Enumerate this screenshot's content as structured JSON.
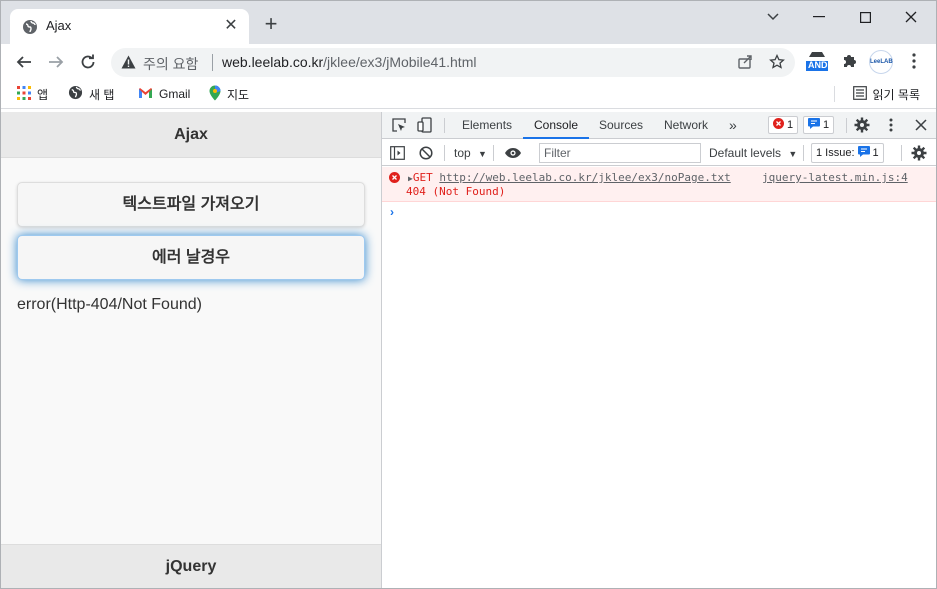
{
  "browser": {
    "tab": {
      "title": "Ajax",
      "favicon": "globe-icon"
    },
    "address": {
      "security_warning": "주의 요함",
      "url_host": "web.leelab.co.kr",
      "url_path": "/jklee/ex3/jMobile41.html"
    },
    "extensions": {
      "and_badge": "AND",
      "profile_label": "LeeLAB"
    },
    "bookmarks": [
      {
        "label": "앱",
        "icon": "apps-grid-icon"
      },
      {
        "label": "새 탭",
        "icon": "globe-icon"
      },
      {
        "label": "Gmail",
        "icon": "gmail-icon"
      },
      {
        "label": "지도",
        "icon": "maps-pin-icon"
      }
    ],
    "reading_list": "읽기 목록"
  },
  "page": {
    "header": "Ajax",
    "buttons": {
      "load_text": "텍스트파일 가져오기",
      "error": "에러 날경우"
    },
    "result": "error(Http-404/Not Found)",
    "footer": "jQuery"
  },
  "devtools": {
    "tabs": [
      "Elements",
      "Console",
      "Sources",
      "Network"
    ],
    "active_tab": "Console",
    "error_count": "1",
    "issue_count": "1",
    "console_bar": {
      "context": "top",
      "filter_placeholder": "Filter",
      "levels": "Default levels",
      "issues_label": "1 Issue:",
      "issues_count": "1"
    },
    "message": {
      "method": "GET",
      "url": "http://web.leelab.co.kr/jklee/ex3/noPage.txt",
      "status": "404 (Not Found)",
      "source": "jquery-latest.min.js:4"
    },
    "prompt": "›",
    "colors": {
      "error_text": "#e0211c",
      "error_bg": "#fff0f0",
      "accent": "#1a73e8"
    }
  }
}
